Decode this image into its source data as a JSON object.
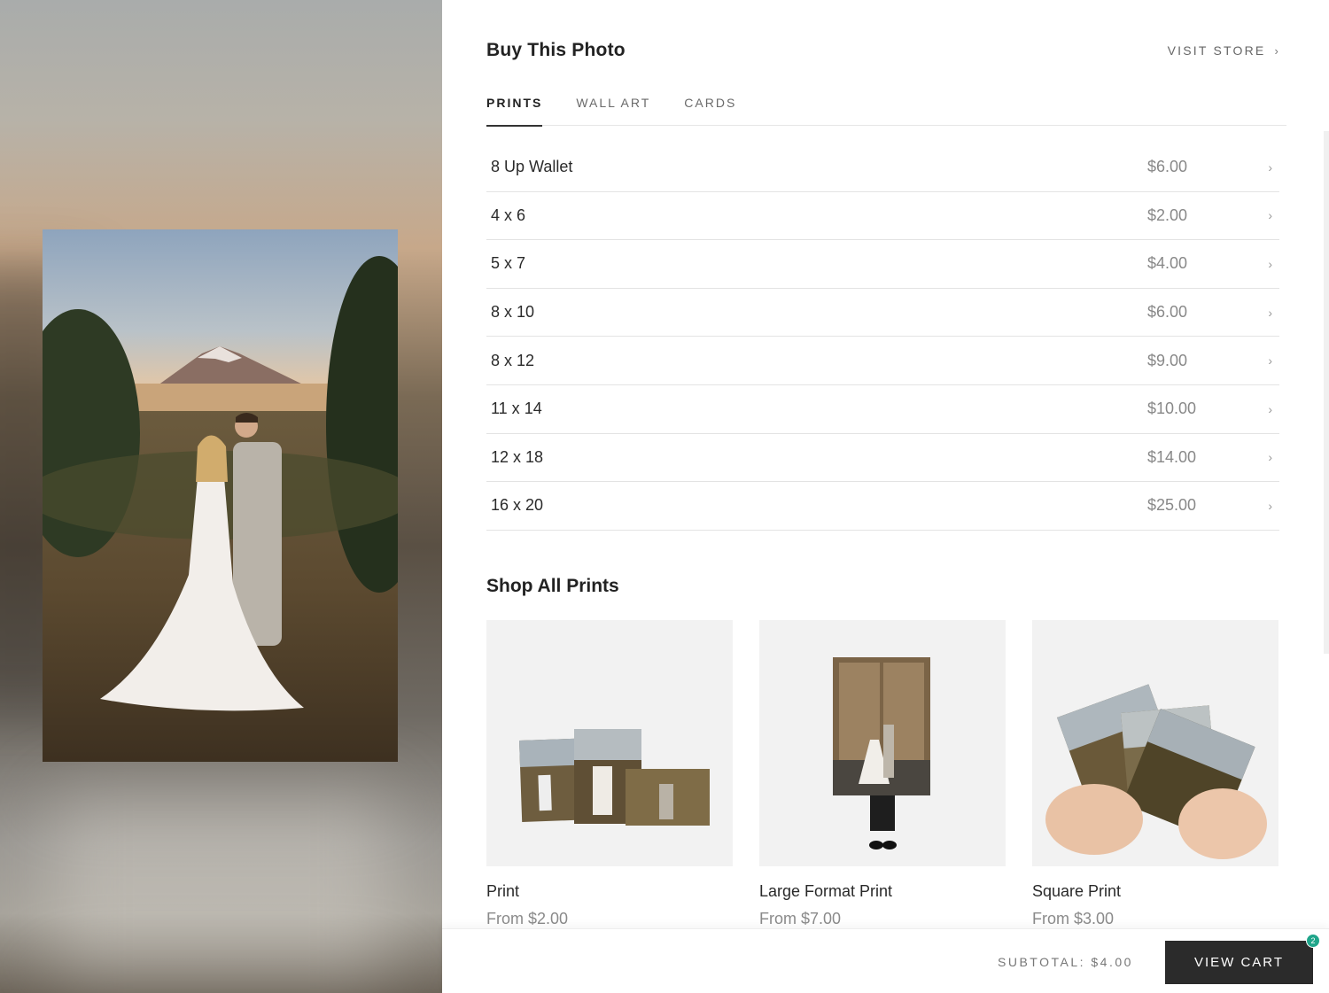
{
  "header": {
    "title": "Buy This Photo",
    "visit_store": "VISIT STORE",
    "visit_store_icon": "chevron-right-icon"
  },
  "tabs": [
    {
      "label": "PRINTS",
      "active": true
    },
    {
      "label": "WALL ART",
      "active": false
    },
    {
      "label": "CARDS",
      "active": false
    }
  ],
  "prints": [
    {
      "size": "8 Up Wallet",
      "price": "$6.00"
    },
    {
      "size": "4 x 6",
      "price": "$2.00"
    },
    {
      "size": "5 x 7",
      "price": "$4.00"
    },
    {
      "size": "8 x 10",
      "price": "$6.00"
    },
    {
      "size": "8 x 12",
      "price": "$9.00"
    },
    {
      "size": "11 x 14",
      "price": "$10.00"
    },
    {
      "size": "12 x 18",
      "price": "$14.00"
    },
    {
      "size": "16 x 20",
      "price": "$25.00"
    }
  ],
  "shop": {
    "title": "Shop All Prints",
    "products": [
      {
        "name": "Print",
        "price": "From $2.00"
      },
      {
        "name": "Large Format Print",
        "price": "From $7.00"
      },
      {
        "name": "Square Print",
        "price": "From $3.00"
      }
    ]
  },
  "footer": {
    "subtotal": "SUBTOTAL: $4.00",
    "view_cart": "VIEW CART",
    "cart_count": "2",
    "accent_color": "#1fa58a",
    "button_color": "#2b2b2b"
  }
}
